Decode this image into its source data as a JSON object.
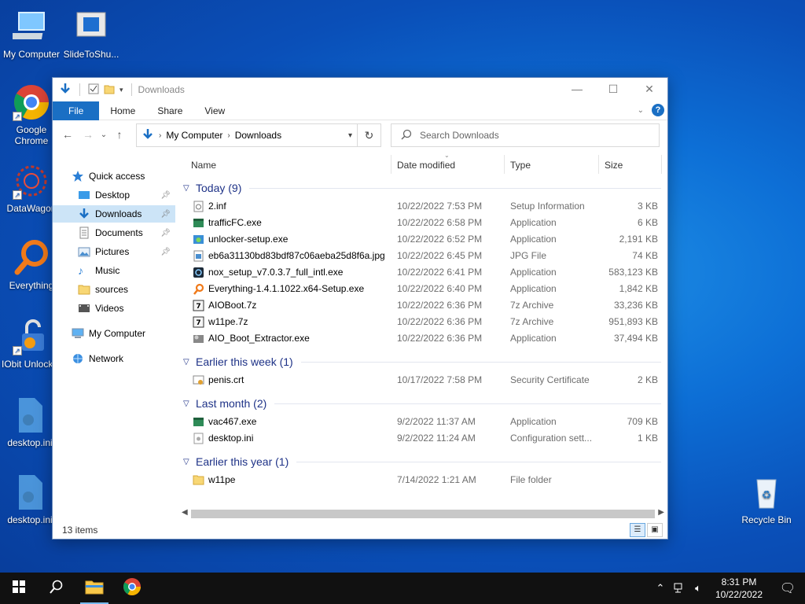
{
  "desktop": {
    "icons": [
      {
        "label": "My Computer",
        "icon": "computer-icon"
      },
      {
        "label": "SlideToShu...",
        "icon": "slide-to-shutdown-icon"
      },
      {
        "label": "Google Chrome",
        "icon": "chrome-icon"
      },
      {
        "label": "DataWagon",
        "icon": "datawagon-icon"
      },
      {
        "label": "Everything",
        "icon": "everything-search-icon"
      },
      {
        "label": "IObit Unlocker",
        "icon": "iobit-unlocker-icon"
      },
      {
        "label": "desktop.ini",
        "icon": "config-file-icon"
      },
      {
        "label": "desktop.ini",
        "icon": "config-file-icon"
      },
      {
        "label": "Recycle Bin",
        "icon": "recycle-bin-icon"
      }
    ]
  },
  "window": {
    "title": "Downloads",
    "caption": {
      "minimize": "—",
      "maximize": "☐",
      "close": "✕"
    },
    "ribbon_tabs": [
      "File",
      "Home",
      "Share",
      "View"
    ],
    "help": "?",
    "address": {
      "root": "My Computer",
      "current": "Downloads"
    },
    "search_placeholder": "Search Downloads",
    "nav": {
      "quick_access": "Quick access",
      "items": [
        {
          "label": "Desktop",
          "pinned": true
        },
        {
          "label": "Downloads",
          "pinned": true,
          "selected": true
        },
        {
          "label": "Documents",
          "pinned": true
        },
        {
          "label": "Pictures",
          "pinned": true
        },
        {
          "label": "Music",
          "pinned": false
        },
        {
          "label": "sources",
          "pinned": false
        },
        {
          "label": "Videos",
          "pinned": false
        }
      ],
      "my_computer": "My Computer",
      "network": "Network"
    },
    "columns": {
      "name": "Name",
      "date": "Date modified",
      "type": "Type",
      "size": "Size"
    },
    "groups": [
      {
        "header": "Today (9)",
        "files": [
          {
            "name": "2.inf",
            "date": "10/22/2022 7:53 PM",
            "type": "Setup Information",
            "size": "3 KB",
            "icon": "inf-file-icon"
          },
          {
            "name": "trafficFC.exe",
            "date": "10/22/2022 6:58 PM",
            "type": "Application",
            "size": "6 KB",
            "icon": "app-icon"
          },
          {
            "name": "unlocker-setup.exe",
            "date": "10/22/2022 6:52 PM",
            "type": "Application",
            "size": "2,191 KB",
            "icon": "installer-icon"
          },
          {
            "name": "eb6a31130bd83bdf87c06aeba25d8f6a.jpg",
            "date": "10/22/2022 6:45 PM",
            "type": "JPG File",
            "size": "74 KB",
            "icon": "image-file-icon"
          },
          {
            "name": "nox_setup_v7.0.3.7_full_intl.exe",
            "date": "10/22/2022 6:41 PM",
            "type": "Application",
            "size": "583,123 KB",
            "icon": "nox-icon"
          },
          {
            "name": "Everything-1.4.1.1022.x64-Setup.exe",
            "date": "10/22/2022 6:40 PM",
            "type": "Application",
            "size": "1,842 KB",
            "icon": "everything-search-icon"
          },
          {
            "name": "AIOBoot.7z",
            "date": "10/22/2022 6:36 PM",
            "type": "7z Archive",
            "size": "33,236 KB",
            "icon": "archive-icon"
          },
          {
            "name": "w11pe.7z",
            "date": "10/22/2022 6:36 PM",
            "type": "7z Archive",
            "size": "951,893 KB",
            "icon": "archive-icon"
          },
          {
            "name": "AIO_Boot_Extractor.exe",
            "date": "10/22/2022 6:36 PM",
            "type": "Application",
            "size": "37,494 KB",
            "icon": "extractor-icon"
          }
        ]
      },
      {
        "header": "Earlier this week (1)",
        "files": [
          {
            "name": "penis.crt",
            "date": "10/17/2022 7:58 PM",
            "type": "Security Certificate",
            "size": "2 KB",
            "icon": "certificate-icon"
          }
        ]
      },
      {
        "header": "Last month (2)",
        "files": [
          {
            "name": "vac467.exe",
            "date": "9/2/2022 11:37 AM",
            "type": "Application",
            "size": "709 KB",
            "icon": "app-icon"
          },
          {
            "name": "desktop.ini",
            "date": "9/2/2022 11:24 AM",
            "type": "Configuration sett...",
            "size": "1 KB",
            "icon": "config-file-icon"
          }
        ]
      },
      {
        "header": "Earlier this year (1)",
        "files": [
          {
            "name": "w11pe",
            "date": "7/14/2022 1:21 AM",
            "type": "File folder",
            "size": "",
            "icon": "folder-icon"
          }
        ]
      }
    ],
    "status": "13 items"
  },
  "taskbar": {
    "clock_time": "8:31 PM",
    "clock_date": "10/22/2022"
  },
  "colors": {
    "accent": "#1a6fc4",
    "selection": "#cce4f7",
    "group_header": "#1e3287"
  }
}
